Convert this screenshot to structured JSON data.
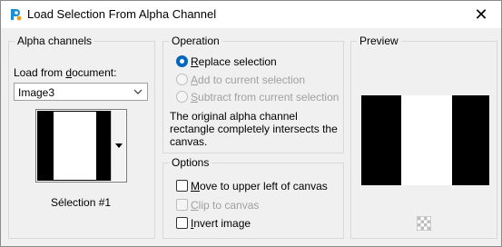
{
  "window": {
    "title": "Load Selection From Alpha Channel",
    "close_glyph": "✕"
  },
  "alpha_channels": {
    "group_title": "Alpha channels",
    "load_from_label": "Load from document:",
    "document_value": "Image3",
    "selection_name": "Sélection #1"
  },
  "operation": {
    "group_title": "Operation",
    "options": [
      {
        "label": "Replace selection",
        "selected": true,
        "enabled": true
      },
      {
        "label": "Add to current selection",
        "selected": false,
        "enabled": false
      },
      {
        "label": "Subtract from current selection",
        "selected": false,
        "enabled": false
      }
    ],
    "description": "The original alpha channel rectangle completely intersects the canvas."
  },
  "options": {
    "group_title": "Options",
    "items": [
      {
        "label": "Move to upper left of canvas",
        "checked": false,
        "enabled": true
      },
      {
        "label": "Clip to canvas",
        "checked": false,
        "enabled": false
      },
      {
        "label": "Invert image",
        "checked": false,
        "enabled": true
      }
    ]
  },
  "preview": {
    "group_title": "Preview"
  },
  "colors": {
    "accent": "#0067c0",
    "selection_black": "#000000",
    "selection_white": "#ffffff"
  },
  "icons": [
    "paint-shop-pro-icon",
    "close-icon",
    "chevron-down-icon",
    "dropdown-arrow-icon",
    "transparency-checker-icon"
  ]
}
